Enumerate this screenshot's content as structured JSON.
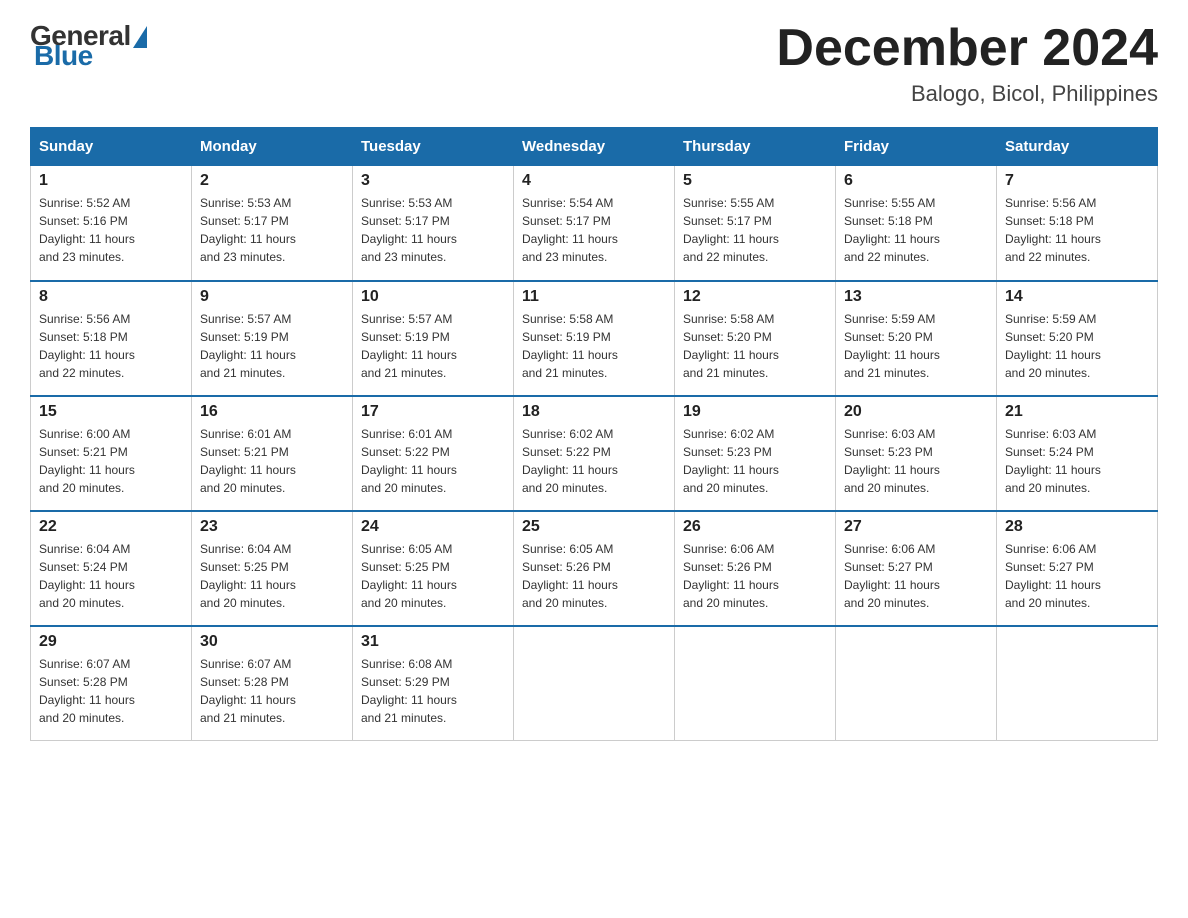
{
  "header": {
    "logo_general": "General",
    "logo_blue": "Blue",
    "month_title": "December 2024",
    "location": "Balogo, Bicol, Philippines"
  },
  "days_of_week": [
    "Sunday",
    "Monday",
    "Tuesday",
    "Wednesday",
    "Thursday",
    "Friday",
    "Saturday"
  ],
  "weeks": [
    [
      {
        "day": "1",
        "sunrise": "5:52 AM",
        "sunset": "5:16 PM",
        "daylight": "11 hours and 23 minutes."
      },
      {
        "day": "2",
        "sunrise": "5:53 AM",
        "sunset": "5:17 PM",
        "daylight": "11 hours and 23 minutes."
      },
      {
        "day": "3",
        "sunrise": "5:53 AM",
        "sunset": "5:17 PM",
        "daylight": "11 hours and 23 minutes."
      },
      {
        "day": "4",
        "sunrise": "5:54 AM",
        "sunset": "5:17 PM",
        "daylight": "11 hours and 23 minutes."
      },
      {
        "day": "5",
        "sunrise": "5:55 AM",
        "sunset": "5:17 PM",
        "daylight": "11 hours and 22 minutes."
      },
      {
        "day": "6",
        "sunrise": "5:55 AM",
        "sunset": "5:18 PM",
        "daylight": "11 hours and 22 minutes."
      },
      {
        "day": "7",
        "sunrise": "5:56 AM",
        "sunset": "5:18 PM",
        "daylight": "11 hours and 22 minutes."
      }
    ],
    [
      {
        "day": "8",
        "sunrise": "5:56 AM",
        "sunset": "5:18 PM",
        "daylight": "11 hours and 22 minutes."
      },
      {
        "day": "9",
        "sunrise": "5:57 AM",
        "sunset": "5:19 PM",
        "daylight": "11 hours and 21 minutes."
      },
      {
        "day": "10",
        "sunrise": "5:57 AM",
        "sunset": "5:19 PM",
        "daylight": "11 hours and 21 minutes."
      },
      {
        "day": "11",
        "sunrise": "5:58 AM",
        "sunset": "5:19 PM",
        "daylight": "11 hours and 21 minutes."
      },
      {
        "day": "12",
        "sunrise": "5:58 AM",
        "sunset": "5:20 PM",
        "daylight": "11 hours and 21 minutes."
      },
      {
        "day": "13",
        "sunrise": "5:59 AM",
        "sunset": "5:20 PM",
        "daylight": "11 hours and 21 minutes."
      },
      {
        "day": "14",
        "sunrise": "5:59 AM",
        "sunset": "5:20 PM",
        "daylight": "11 hours and 20 minutes."
      }
    ],
    [
      {
        "day": "15",
        "sunrise": "6:00 AM",
        "sunset": "5:21 PM",
        "daylight": "11 hours and 20 minutes."
      },
      {
        "day": "16",
        "sunrise": "6:01 AM",
        "sunset": "5:21 PM",
        "daylight": "11 hours and 20 minutes."
      },
      {
        "day": "17",
        "sunrise": "6:01 AM",
        "sunset": "5:22 PM",
        "daylight": "11 hours and 20 minutes."
      },
      {
        "day": "18",
        "sunrise": "6:02 AM",
        "sunset": "5:22 PM",
        "daylight": "11 hours and 20 minutes."
      },
      {
        "day": "19",
        "sunrise": "6:02 AM",
        "sunset": "5:23 PM",
        "daylight": "11 hours and 20 minutes."
      },
      {
        "day": "20",
        "sunrise": "6:03 AM",
        "sunset": "5:23 PM",
        "daylight": "11 hours and 20 minutes."
      },
      {
        "day": "21",
        "sunrise": "6:03 AM",
        "sunset": "5:24 PM",
        "daylight": "11 hours and 20 minutes."
      }
    ],
    [
      {
        "day": "22",
        "sunrise": "6:04 AM",
        "sunset": "5:24 PM",
        "daylight": "11 hours and 20 minutes."
      },
      {
        "day": "23",
        "sunrise": "6:04 AM",
        "sunset": "5:25 PM",
        "daylight": "11 hours and 20 minutes."
      },
      {
        "day": "24",
        "sunrise": "6:05 AM",
        "sunset": "5:25 PM",
        "daylight": "11 hours and 20 minutes."
      },
      {
        "day": "25",
        "sunrise": "6:05 AM",
        "sunset": "5:26 PM",
        "daylight": "11 hours and 20 minutes."
      },
      {
        "day": "26",
        "sunrise": "6:06 AM",
        "sunset": "5:26 PM",
        "daylight": "11 hours and 20 minutes."
      },
      {
        "day": "27",
        "sunrise": "6:06 AM",
        "sunset": "5:27 PM",
        "daylight": "11 hours and 20 minutes."
      },
      {
        "day": "28",
        "sunrise": "6:06 AM",
        "sunset": "5:27 PM",
        "daylight": "11 hours and 20 minutes."
      }
    ],
    [
      {
        "day": "29",
        "sunrise": "6:07 AM",
        "sunset": "5:28 PM",
        "daylight": "11 hours and 20 minutes."
      },
      {
        "day": "30",
        "sunrise": "6:07 AM",
        "sunset": "5:28 PM",
        "daylight": "11 hours and 21 minutes."
      },
      {
        "day": "31",
        "sunrise": "6:08 AM",
        "sunset": "5:29 PM",
        "daylight": "11 hours and 21 minutes."
      },
      null,
      null,
      null,
      null
    ]
  ],
  "labels": {
    "sunrise": "Sunrise:",
    "sunset": "Sunset:",
    "daylight": "Daylight:"
  }
}
